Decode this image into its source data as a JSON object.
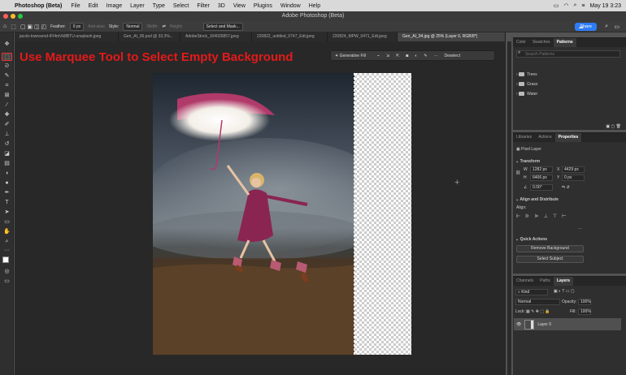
{
  "menubar": {
    "app": "Photoshop (Beta)",
    "items": [
      "File",
      "Edit",
      "Image",
      "Layer",
      "Type",
      "Select",
      "Filter",
      "3D",
      "View",
      "Plugins",
      "Window",
      "Help"
    ],
    "datetime": "May 19  3:23"
  },
  "window": {
    "title": "Adobe Photoshop (Beta)"
  },
  "options": {
    "feather_label": "Feather:",
    "feather_value": "0 px",
    "antialias": "Anti-alias",
    "style_label": "Style:",
    "style_value": "Normal",
    "width_label": "Width:",
    "height_label": "Height:",
    "select_mask": "Select and Mask...",
    "share": "Share"
  },
  "tabs": [
    "jacob-townsend-IFl4mVk8BTU-unsplash.jpeg",
    "Gen_AI_06.psd @ 33.3%...",
    "AdobeStock_104026857.jpeg",
    "220822_untitled_0747_Edt.jpeg",
    "220824_MPW_0471_Edt.jpeg",
    "Gen_AI_04.jpg @ 25% (Layer 0, RGB/8*)"
  ],
  "canvas": {
    "instruction": "Use Marquee Tool to Select Empty Background",
    "taskbar": {
      "generative_fill": "Generative Fill",
      "deselect": "Deselect"
    }
  },
  "patterns_panel": {
    "tabs": [
      "Color",
      "Swatches",
      "Patterns"
    ],
    "search_placeholder": "Search Patterns",
    "folders": [
      "Trees",
      "Grass",
      "Water"
    ]
  },
  "properties_panel": {
    "tabs": [
      "Libraries",
      "Actions",
      "Properties"
    ],
    "kind": "Pixel Layer",
    "transform_title": "Transform",
    "w_label": "W",
    "w_value": "1282 px",
    "x_label": "X",
    "x_value": "4429 px",
    "h_label": "H",
    "h_value": "6406 px",
    "y_label": "Y",
    "y_value": "0 px",
    "angle": "0.00°",
    "align_title": "Align and Distribute",
    "align_label": "Align:",
    "quick_actions_title": "Quick Actions",
    "remove_bg": "Remove Background",
    "select_subject": "Select Subject"
  },
  "layers_panel": {
    "tabs": [
      "Channels",
      "Paths",
      "Layers"
    ],
    "kind": "Kind",
    "blend": "Normal",
    "opacity_label": "Opacity:",
    "opacity_value": "100%",
    "lock_label": "Lock:",
    "fill_label": "Fill:",
    "fill_value": "100%",
    "layer_name": "Layer 0"
  }
}
